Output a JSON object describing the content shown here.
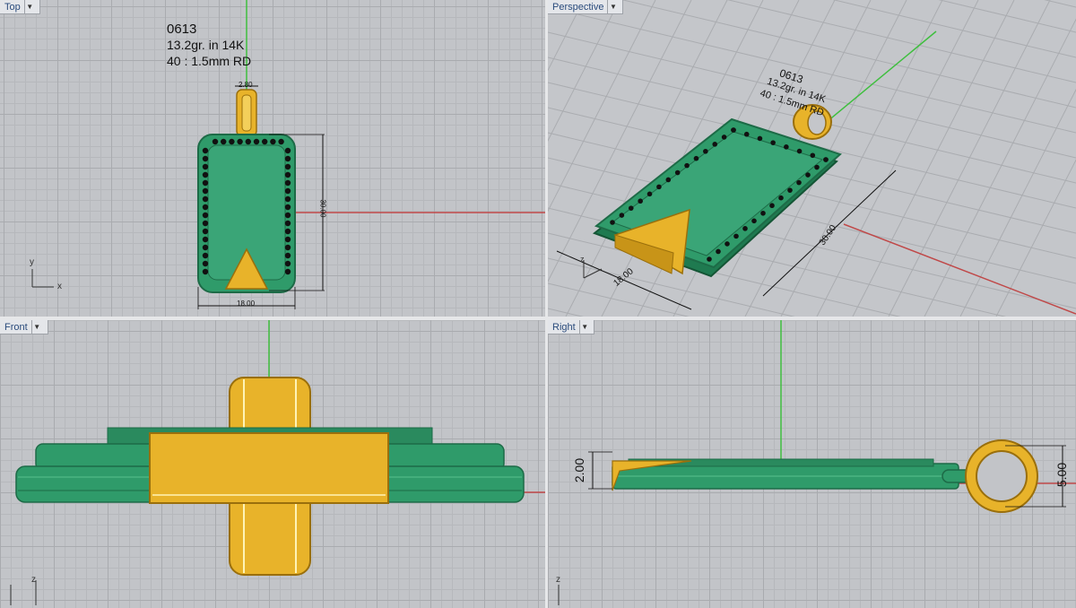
{
  "viewports": {
    "top": {
      "label": "Top"
    },
    "perspective": {
      "label": "Perspective"
    },
    "front": {
      "label": "Front"
    },
    "right": {
      "label": "Right"
    }
  },
  "annotation": {
    "line1": "0613",
    "line2": "13.2gr.  in 14K",
    "line3": "40 : 1.5mm  RD"
  },
  "dimensions": {
    "bail_width": "2.80",
    "height": "30.00",
    "width": "18.00",
    "thickness": "2.00",
    "bail_diameter": "5.00"
  },
  "axes": {
    "x": "x",
    "y": "y",
    "z": "z"
  },
  "colors": {
    "body": "#2f9b6a",
    "body_dark": "#1d6b47",
    "gold": "#e8b32a",
    "gold_dark": "#a87a10",
    "axis_red": "#c04848",
    "axis_green": "#3fbf3f"
  },
  "icons": {
    "dropdown": "caret-down-icon"
  }
}
